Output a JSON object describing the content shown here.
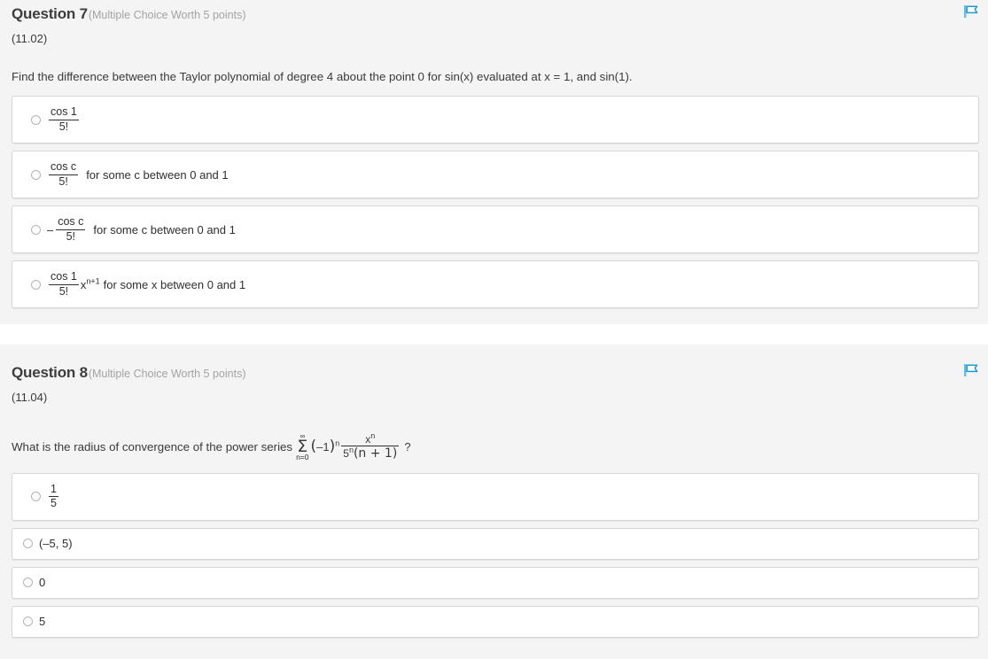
{
  "page": {
    "background_color": "#ffffff",
    "block_background_color": "#f4f4f4",
    "flag_icon_color": "#2196d6"
  },
  "questions": [
    {
      "title": "Question 7",
      "meta": "(Multiple Choice Worth 5 points)",
      "code": "(11.02)",
      "prompt": "Find the difference between the Taylor polynomial of degree 4 about the point 0 for sin(x) evaluated at x = 1, and sin(1).",
      "flag_icon": "flag-icon",
      "options": [
        {
          "id": "q7-option-1",
          "numerator": "cos 1",
          "denominator": "5!",
          "trailing_text": "",
          "negative": false,
          "suffix_variable": "",
          "suffix_exponent": ""
        },
        {
          "id": "q7-option-2",
          "numerator": "cos c",
          "denominator": "5!",
          "trailing_text": "for some c between 0 and 1",
          "negative": false,
          "suffix_variable": "",
          "suffix_exponent": ""
        },
        {
          "id": "q7-option-3",
          "numerator": "cos c",
          "denominator": "5!",
          "trailing_text": "for some c between 0 and 1",
          "negative": true,
          "negative_sign": "–",
          "suffix_variable": "",
          "suffix_exponent": ""
        },
        {
          "id": "q7-option-4",
          "numerator": "cos 1",
          "denominator": "5!",
          "trailing_text": "for some x between 0 and 1",
          "negative": false,
          "suffix_variable": "x",
          "suffix_exponent": "n+1"
        }
      ]
    },
    {
      "title": "Question 8",
      "meta": "(Multiple Choice Worth 5 points)",
      "code": "(11.04)",
      "prompt": "What is the radius of convergence of the power series",
      "flag_icon": "flag-icon",
      "formula": {
        "sigma_top": "∞",
        "sigma_symbol": "Σ",
        "sigma_bottom": "n=0",
        "factor_open": "(",
        "factor_base": "–1",
        "factor_close": ")",
        "factor_exponent": "n",
        "fraction_numerator": "x",
        "fraction_numerator_exponent": "n",
        "fraction_denominator_base": "5",
        "fraction_denominator_exponent": "n",
        "fraction_denominator_paren": "(n + 1)",
        "question_mark": "?"
      },
      "options": [
        {
          "id": "q8-option-1",
          "type": "fraction",
          "numerator": "1",
          "denominator": "5"
        },
        {
          "id": "q8-option-2",
          "type": "text",
          "label": "(–5, 5)"
        },
        {
          "id": "q8-option-3",
          "type": "text",
          "label": "0"
        },
        {
          "id": "q8-option-4",
          "type": "text",
          "label": "5"
        }
      ]
    }
  ]
}
